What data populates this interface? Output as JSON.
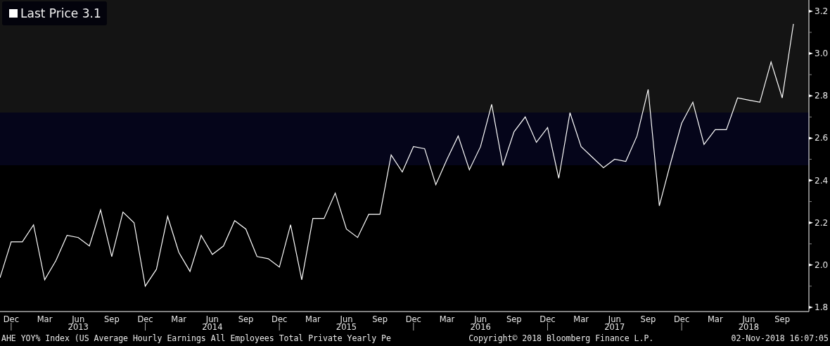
{
  "chart": {
    "legend": {
      "value": "3.1"
    },
    "chart_data": {
      "type": "line",
      "ylim": [
        1.78,
        3.253
      ],
      "categories": [
        null,
        "Dec",
        null,
        null,
        "Mar",
        null,
        null,
        "Jun",
        null,
        null,
        "Sep",
        null,
        null,
        "Dec",
        null,
        null,
        "Mar",
        null,
        null,
        "Jun",
        null,
        null,
        "Sep",
        null,
        null,
        "Dec",
        null,
        null,
        "Mar",
        null,
        null,
        "Jun",
        null,
        null,
        "Sep",
        null,
        null,
        "Dec",
        null,
        null,
        "Mar",
        null,
        null,
        "Jun",
        null,
        null,
        "Sep",
        null,
        null,
        "Dec",
        null,
        null,
        "Mar",
        null,
        null,
        "Jun",
        null,
        null,
        "Sep",
        null,
        null,
        "Dec",
        null,
        null,
        "Mar",
        null,
        null,
        "Jun",
        null,
        null,
        "Sep",
        null
      ],
      "yticks": [
        {
          "value": 1.8,
          "label": "1.8"
        },
        {
          "value": 2.0,
          "label": "2.0"
        },
        {
          "value": 2.2,
          "label": "2.2"
        },
        {
          "value": 2.4,
          "label": "2.4"
        },
        {
          "value": 2.6,
          "label": "2.6"
        },
        {
          "value": 2.8,
          "label": "2.8"
        },
        {
          "value": 3.0,
          "label": "3.0"
        },
        {
          "value": 3.2,
          "label": "3.2"
        }
      ],
      "series": [
        {
          "name": "Last Price",
          "color": "#ffffff",
          "values": [
            1.94,
            2.11,
            2.11,
            2.19,
            1.93,
            2.02,
            2.14,
            2.13,
            2.09,
            2.26,
            2.04,
            2.25,
            2.2,
            1.9,
            1.98,
            2.23,
            2.06,
            1.97,
            2.14,
            2.05,
            2.09,
            2.21,
            2.17,
            2.04,
            2.03,
            1.99,
            2.19,
            1.93,
            2.22,
            2.22,
            2.34,
            2.17,
            2.13,
            2.24,
            2.24,
            2.52,
            2.44,
            2.56,
            2.55,
            2.38,
            2.5,
            2.61,
            2.45,
            2.56,
            2.76,
            2.47,
            2.63,
            2.7,
            2.58,
            2.65,
            2.41,
            2.72,
            2.56,
            2.51,
            2.46,
            2.5,
            2.49,
            2.61,
            2.83,
            2.28,
            2.48,
            2.67,
            2.77,
            2.57,
            2.64,
            2.64,
            2.79,
            2.78,
            2.77,
            2.96,
            2.79,
            3.14
          ]
        }
      ]
    },
    "year_labels": [
      "2013",
      "2014",
      "2015",
      "2016",
      "2017",
      "2018"
    ]
  },
  "footer": {
    "description": "AHE YOY% Index (US Average Hourly Earnings All Employees Total Private Yearly Pe",
    "copyright": "Copyright© 2018 Bloomberg Finance L.P.",
    "timestamp": "02-Nov-2018 16:07:05"
  }
}
